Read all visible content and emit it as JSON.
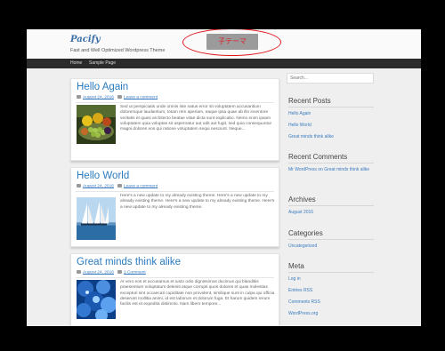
{
  "header": {
    "site_title": "Pacify",
    "tagline": "Fast and Well Optimized Wordpress Theme",
    "child_theme_label": "子テーマ"
  },
  "nav": {
    "items": [
      "Home",
      "Sample Page"
    ]
  },
  "posts": [
    {
      "title": "Hello Again",
      "date": "August 24, 2016",
      "comments": "Leave a comment",
      "excerpt": "Sed ut perspiciatis unde omnis iste natus error sit voluptatem accusantium doloremque laudantium, totam rem aperiam, eaque ipsa quae ab illo inventore veritatis et quasi architecto beatae vitae dicta sunt explicabo. Nemo enim ipsam voluptatem quia voluptas sit aspernatur aut odit aut fugit, sed quia consequuntur magni dolores eos qui ratione voluptatem sequi nesciunt. Neque..."
    },
    {
      "title": "Hello World",
      "date": "August 24, 2016",
      "comments": "Leave a comment",
      "excerpt": "Here's a new update to my already existing theme. Here's a new update to my already existing theme. Here's a new update to my already existing theme. Here's a new update to my already existing theme."
    },
    {
      "title": "Great minds think alike",
      "date": "August 24, 2016",
      "comments": "1 Comment",
      "excerpt": "At vero eos et accusamus et iusto odio dignissimos ducimus qui blanditiis praesentium voluptatum deleniti atque corrupti quos dolores et quas molestias excepturi sint occaecati cupiditate non provident, similique sunt in culpa qui officia deserunt mollitia animi, id est laborum et dolorum fuga. Et harum quidem rerum facilis est et expedita distinctio. Nam libero tempore..."
    }
  ],
  "sidebar": {
    "search_placeholder": "Search...",
    "recent_posts_title": "Recent Posts",
    "recent_posts": [
      "Hello Again",
      "Hello World",
      "Great minds think alike"
    ],
    "recent_comments_title": "Recent Comments",
    "recent_comment": "Mr WordPress on Great minds think alike",
    "archives_title": "Archives",
    "archives": [
      "August 2016"
    ],
    "categories_title": "Categories",
    "categories": [
      "Uncategorized"
    ],
    "meta_title": "Meta",
    "meta_links": [
      "Log in",
      "Entries RSS",
      "Comments RSS",
      "WordPress.org"
    ]
  },
  "colors": {
    "accent": "#2a7bbf",
    "nav_bg": "#2b2b2b",
    "highlight": "#e0181e"
  }
}
